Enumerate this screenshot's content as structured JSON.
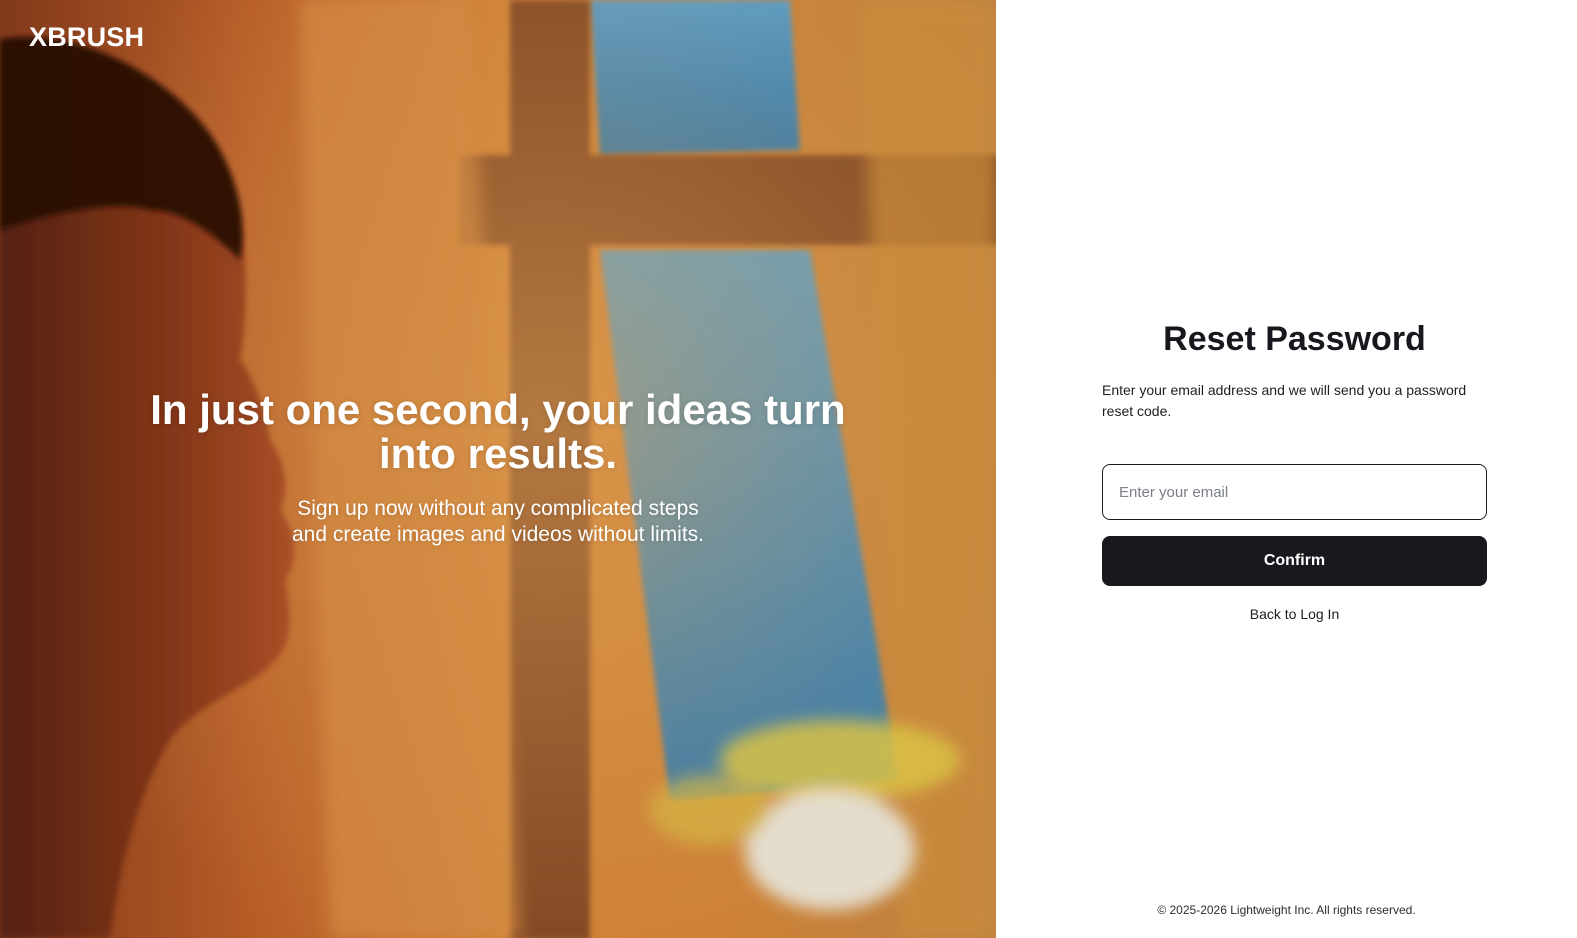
{
  "brand": {
    "name": "XBRUSH"
  },
  "hero": {
    "headline": "In just one second, your ideas turn into results.",
    "sub_line_1": "Sign up now without any complicated steps",
    "sub_line_2": "and create images and videos without limits."
  },
  "reset_form": {
    "title": "Reset Password",
    "description": "Enter your email address and we will send you a password reset code.",
    "email_placeholder": "Enter your email",
    "email_value": "",
    "confirm_label": "Confirm",
    "back_link_label": "Back to Log In"
  },
  "footer": {
    "copyright": "© 2025-2026 Lightweight Inc. All rights reserved."
  },
  "colors": {
    "button_bg": "#17191d",
    "text_dark": "#16181d",
    "hero_orange": "#c76a2a",
    "window_blue": "#3f8fc7"
  }
}
